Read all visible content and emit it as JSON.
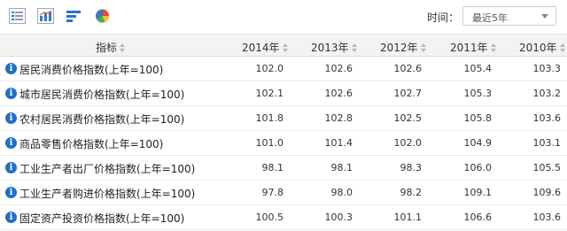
{
  "toolbar": {
    "icons": [
      "list-view-icon",
      "chart-icon",
      "bar-chart-icon",
      "pie-chart-icon"
    ],
    "time_label": "时间：",
    "time_select_value": "最近5年"
  },
  "table": {
    "indicator_header": "指标",
    "years": [
      "2014年",
      "2013年",
      "2012年",
      "2011年",
      "2010年"
    ],
    "rows": [
      {
        "name": "居民消费价格指数(上年=100)",
        "values": [
          "102.0",
          "102.6",
          "102.6",
          "105.4",
          "103.3"
        ]
      },
      {
        "name": "城市居民消费价格指数(上年=100)",
        "values": [
          "102.1",
          "102.6",
          "102.7",
          "105.3",
          "103.2"
        ]
      },
      {
        "name": "农村居民消费价格指数(上年=100)",
        "values": [
          "101.8",
          "102.8",
          "102.5",
          "105.8",
          "103.6"
        ]
      },
      {
        "name": "商品零售价格指数(上年=100)",
        "values": [
          "101.0",
          "101.4",
          "102.0",
          "104.9",
          "103.1"
        ]
      },
      {
        "name": "工业生产者出厂价格指数(上年=100)",
        "values": [
          "98.1",
          "98.1",
          "98.3",
          "106.0",
          "105.5"
        ]
      },
      {
        "name": "工业生产者购进价格指数(上年=100)",
        "values": [
          "97.8",
          "98.0",
          "98.2",
          "109.1",
          "109.6"
        ]
      },
      {
        "name": "固定资产投资价格指数(上年=100)",
        "values": [
          "100.5",
          "100.3",
          "101.1",
          "106.6",
          "103.6"
        ]
      }
    ]
  },
  "colors": {
    "info_icon": "#1f6fc7",
    "header_bg": "#f3f3f3"
  }
}
